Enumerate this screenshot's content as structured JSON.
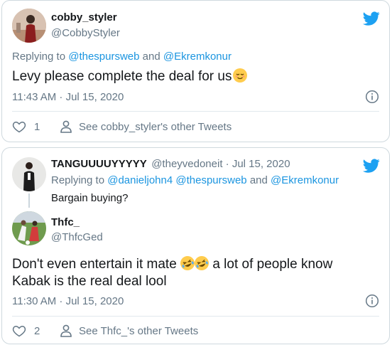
{
  "tweet1": {
    "display_name": "cobby_styler",
    "handle": "@CobbyStyler",
    "replying_prefix": "Replying to",
    "replying_to_1": "@thespursweb",
    "replying_and": "and",
    "replying_to_2": "@Ekremkonur",
    "text": "Levy please complete the deal for us",
    "emoji_name": "relieved-face",
    "timestamp": "11:43 AM · Jul 15, 2020",
    "like_count": "1",
    "other_tweets": "See cobby_styler's other Tweets"
  },
  "tweet2": {
    "quoted": {
      "display_name": "TANGUUUUYYYYY",
      "handle_date": "@theyvedoneit · Jul 15, 2020",
      "replying_prefix": "Replying to",
      "replying_to_1": "@danieljohn4",
      "replying_to_2": "@thespursweb",
      "replying_and": "and",
      "replying_to_3": "@Ekremkonur",
      "text": "Bargain buying?"
    },
    "display_name": "Thfc_",
    "handle": "@ThfcGed",
    "text_part1": "Don't even entertain it mate",
    "text_part2": "a lot of people know",
    "text_line2": "Kabak is the real deal lool",
    "emoji_name": "rolling-on-floor-laughing",
    "timestamp": "11:30 AM · Jul 15, 2020",
    "like_count": "2",
    "other_tweets": "See Thfc_'s other Tweets"
  },
  "colors": {
    "twitter_blue": "#1da1f2",
    "link_blue": "#1b95e0",
    "grey_text": "#657786",
    "border": "#cfd9de"
  },
  "icons": {
    "brand": "twitter-bird-icon",
    "info": "info-icon",
    "like": "heart-icon",
    "profile": "person-icon"
  }
}
